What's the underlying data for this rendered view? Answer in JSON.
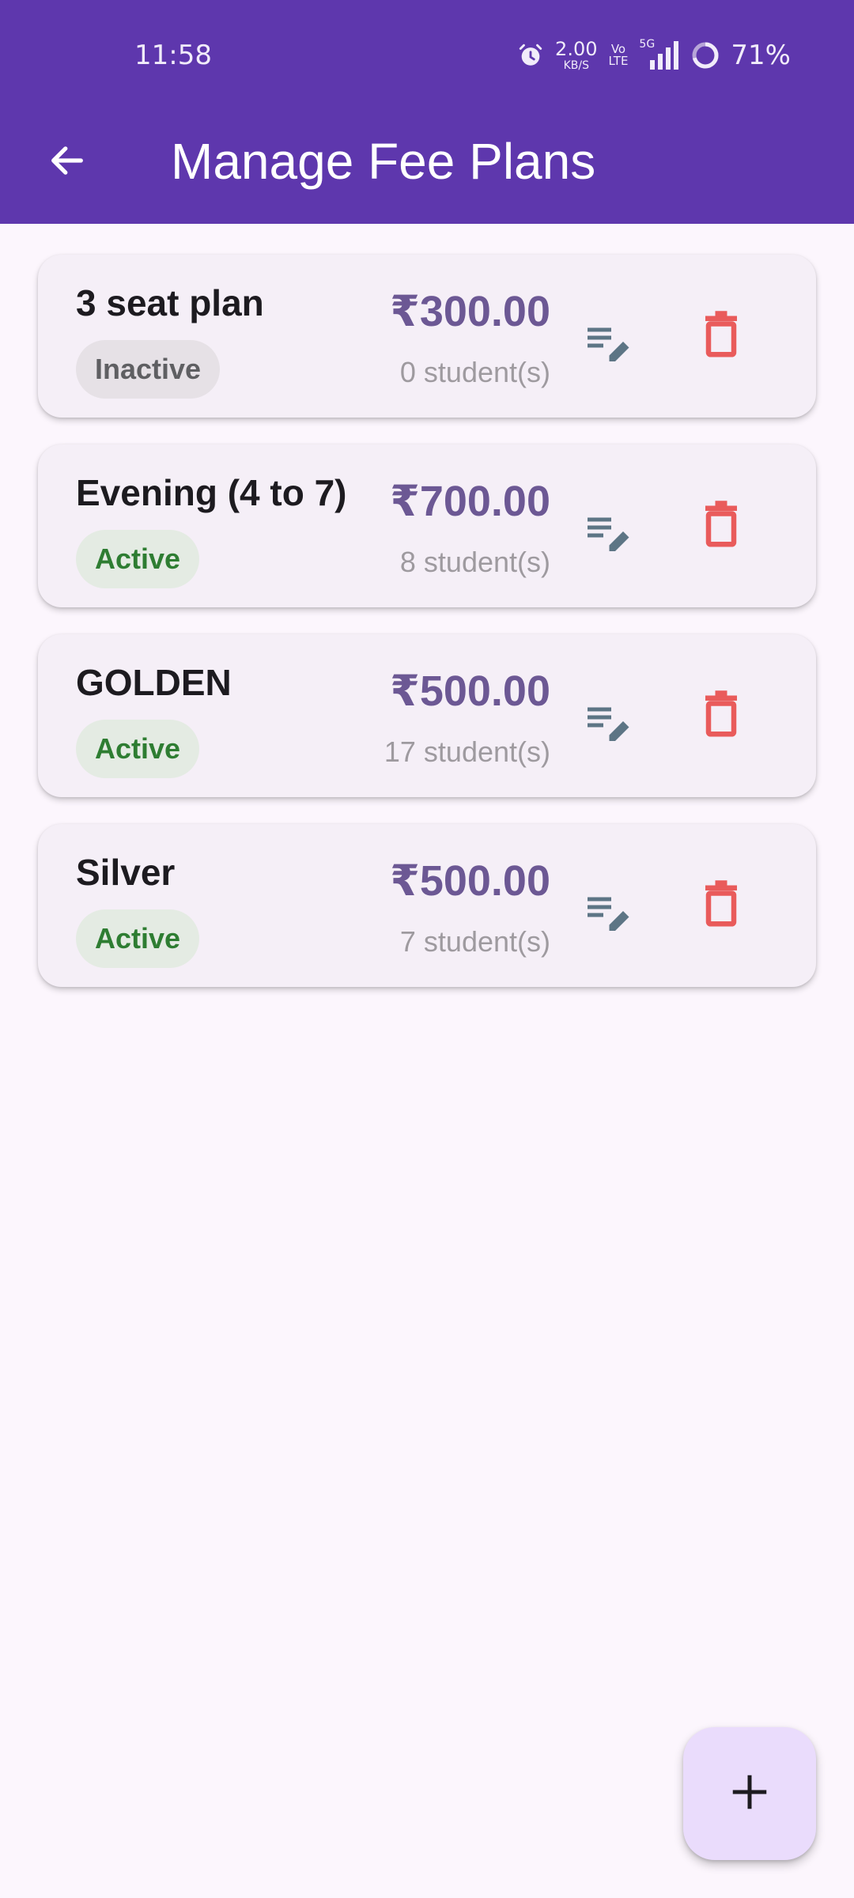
{
  "status_bar": {
    "time": "11:58",
    "net_speed_value": "2.00",
    "net_speed_unit": "KB/S",
    "volte_top": "Vo",
    "volte_bottom": "LTE",
    "signal_label": "5G",
    "battery": "71%",
    "icons": [
      "alarm-icon",
      "signal-icon",
      "battery-ring-icon"
    ]
  },
  "app_bar": {
    "title": "Manage Fee Plans",
    "back_icon": "arrow-back-icon",
    "background": "#5e37ad"
  },
  "plans": [
    {
      "name": "3 seat plan",
      "status": "Inactive",
      "price": "₹300.00",
      "students": "0 student(s)"
    },
    {
      "name": "Evening (4 to 7)",
      "status": "Active",
      "price": "₹700.00",
      "students": "8 student(s)"
    },
    {
      "name": "GOLDEN",
      "status": "Active",
      "price": "₹500.00",
      "students": "17 student(s)"
    },
    {
      "name": "Silver",
      "status": "Active",
      "price": "₹500.00",
      "students": "7 student(s)"
    }
  ],
  "actions": {
    "edit_icon": "edit-list-icon",
    "delete_icon": "trash-icon"
  },
  "fab": {
    "icon": "plus-icon"
  },
  "colors": {
    "accent": "#5e37ad",
    "price": "#6c5894",
    "active_text": "#2e7d32",
    "delete": "#e95b5b",
    "edit": "#5d7585"
  }
}
